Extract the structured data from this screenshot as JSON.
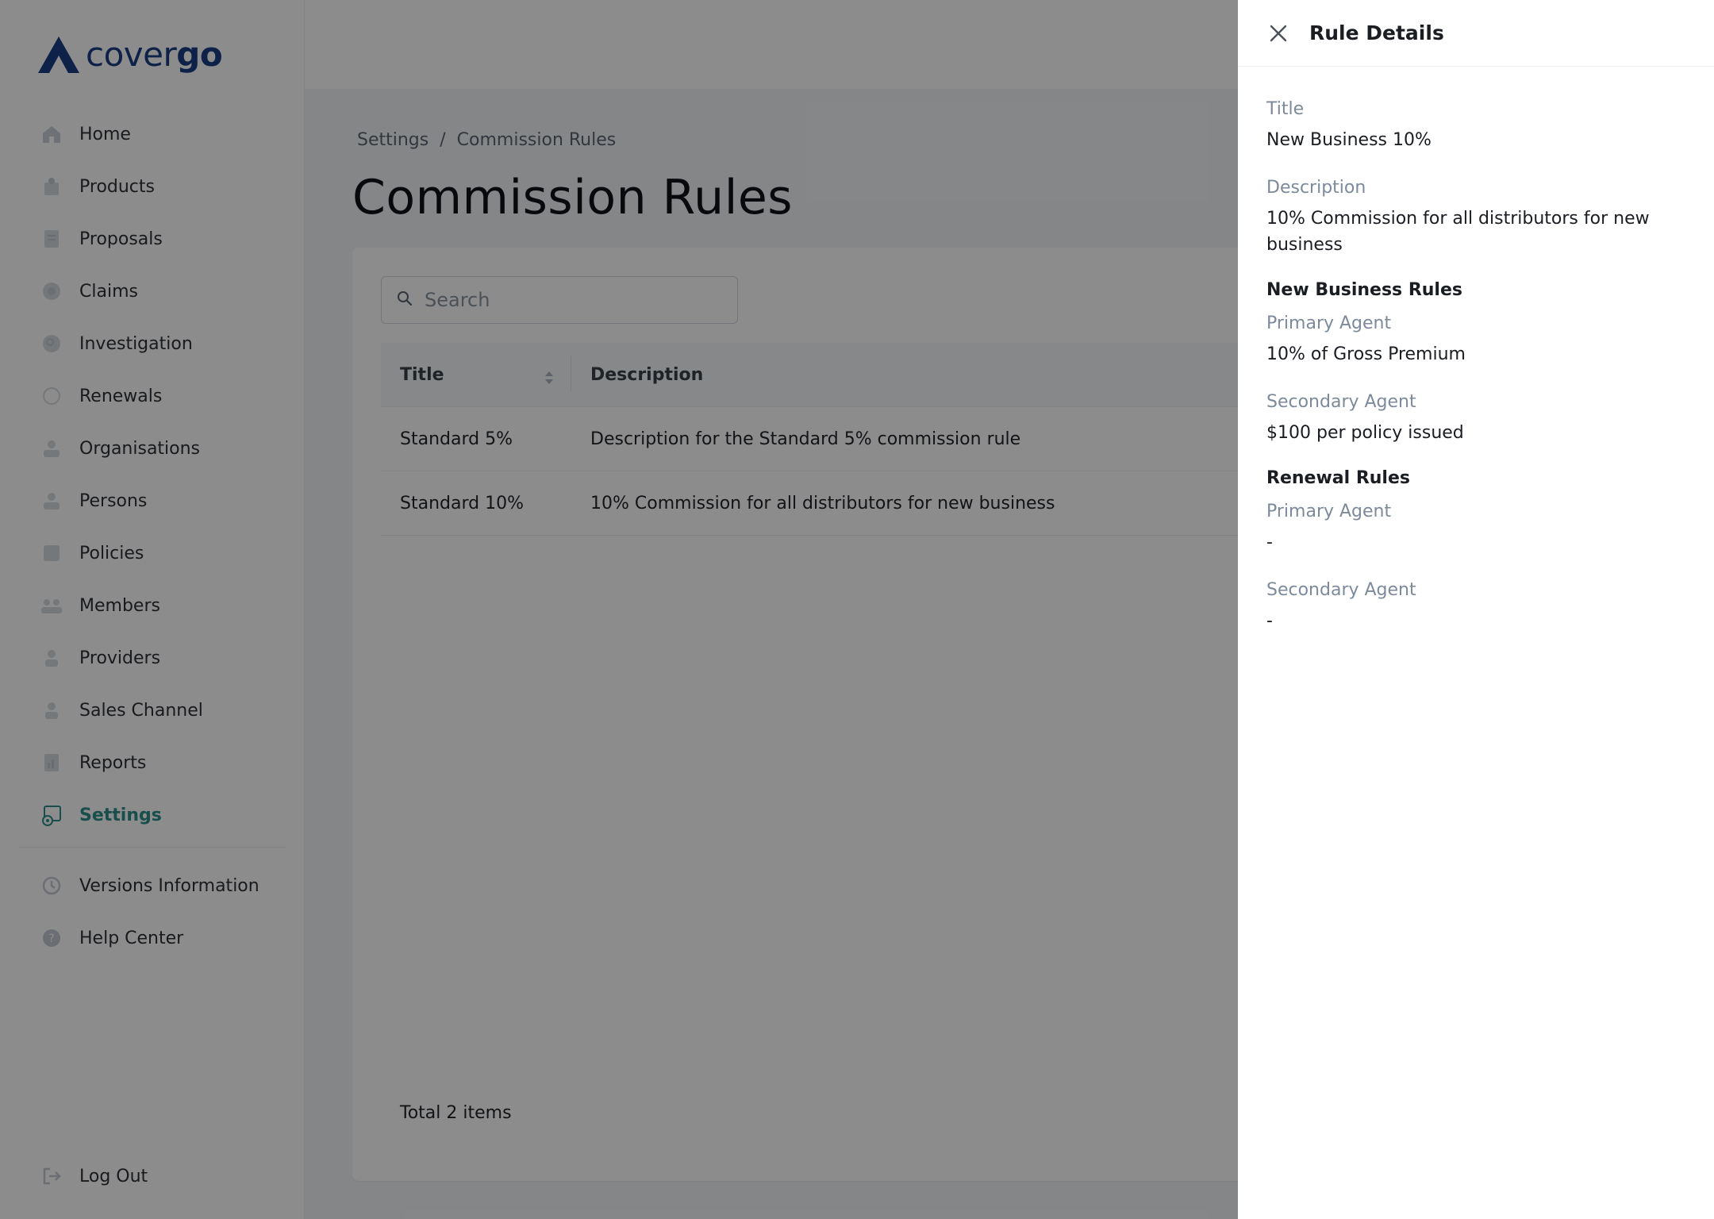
{
  "brand": {
    "name_light": "cover",
    "name_bold": "go",
    "color": "#1b3f86",
    "accent": "#2c8f8a"
  },
  "sidebar": {
    "items": [
      {
        "label": "Home",
        "icon": "home-icon"
      },
      {
        "label": "Products",
        "icon": "products-icon"
      },
      {
        "label": "Proposals",
        "icon": "proposals-icon"
      },
      {
        "label": "Claims",
        "icon": "claims-icon"
      },
      {
        "label": "Investigation",
        "icon": "investigation-icon"
      },
      {
        "label": "Renewals",
        "icon": "renewals-icon"
      },
      {
        "label": "Organisations",
        "icon": "organisations-icon"
      },
      {
        "label": "Persons",
        "icon": "persons-icon"
      },
      {
        "label": "Policies",
        "icon": "policies-icon"
      },
      {
        "label": "Members",
        "icon": "members-icon"
      },
      {
        "label": "Providers",
        "icon": "providers-icon"
      },
      {
        "label": "Sales Channel",
        "icon": "sales-channel-icon"
      },
      {
        "label": "Reports",
        "icon": "reports-icon"
      },
      {
        "label": "Settings",
        "icon": "settings-icon",
        "active": true
      }
    ],
    "bottom_items": [
      {
        "label": "Versions Information",
        "icon": "history-icon"
      },
      {
        "label": "Help Center",
        "icon": "help-icon"
      }
    ],
    "logout": {
      "label": "Log Out",
      "icon": "logout-icon"
    }
  },
  "main": {
    "breadcrumb": {
      "parent": "Settings",
      "separator": "/",
      "current": "Commission Rules"
    },
    "title": "Commission Rules",
    "search": {
      "placeholder": "Search",
      "value": ""
    },
    "table": {
      "columns": [
        "Title",
        "Description"
      ],
      "rows": [
        {
          "title": "Standard 5%",
          "description": "Description for the Standard 5% commission rule"
        },
        {
          "title": "Standard 10%",
          "description": "10% Commission for all distributors for new business"
        }
      ]
    },
    "total": "Total 2 items"
  },
  "drawer": {
    "title": "Rule Details",
    "fields": {
      "title_label": "Title",
      "title_value": "New Business 10%",
      "description_label": "Description",
      "description_value": "10% Commission for all distributors for new business"
    },
    "new_business": {
      "heading": "New Business Rules",
      "primary_label": "Primary Agent",
      "primary_value": "10% of Gross Premium",
      "secondary_label": "Secondary Agent",
      "secondary_value": "$100 per policy issued"
    },
    "renewal": {
      "heading": "Renewal Rules",
      "primary_label": "Primary Agent",
      "primary_value": "-",
      "secondary_label": "Secondary Agent",
      "secondary_value": "-"
    }
  }
}
